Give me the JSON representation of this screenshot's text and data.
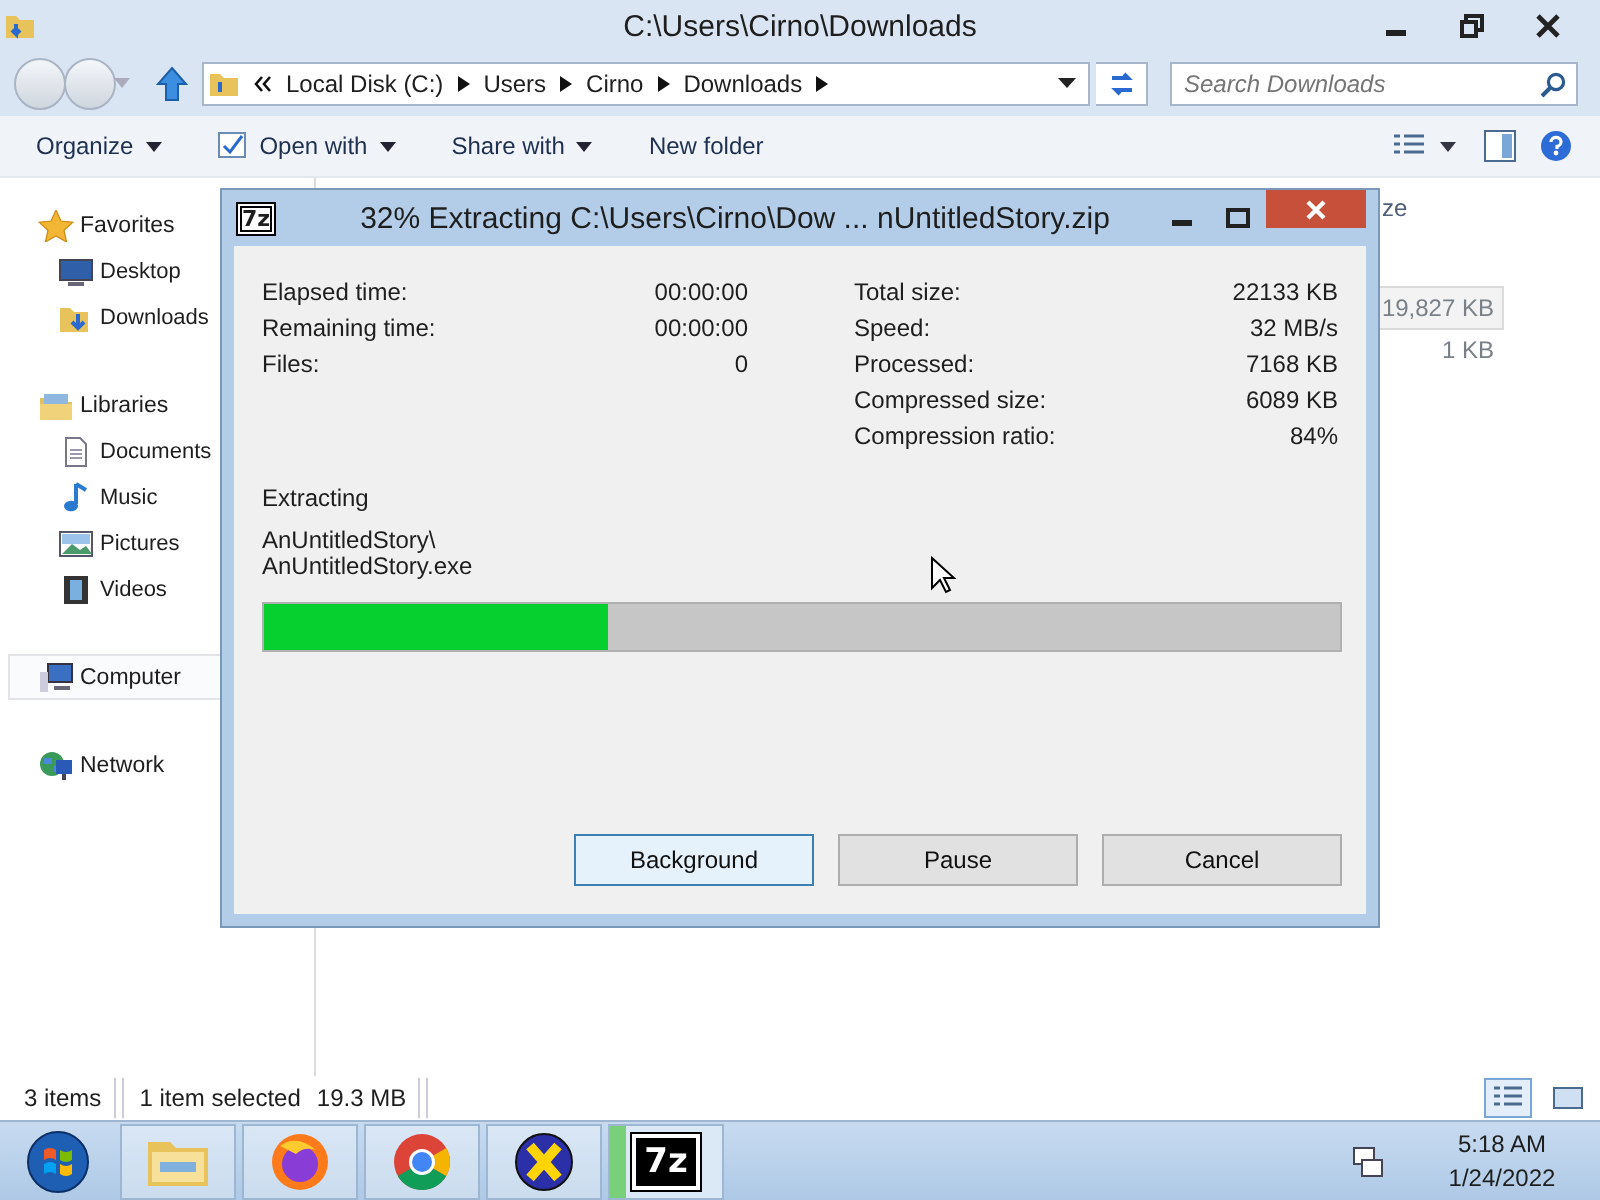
{
  "explorer": {
    "title": "C:\\Users\\Cirno\\Downloads",
    "address": {
      "crumbs": [
        "Local Disk (C:)",
        "Users",
        "Cirno",
        "Downloads"
      ]
    },
    "search": {
      "placeholder": "Search Downloads"
    },
    "commands": [
      {
        "label": "Open with",
        "kind": "openwith"
      },
      {
        "label": "Share with",
        "kind": "menu"
      },
      {
        "label": "New folder",
        "kind": "plain"
      }
    ],
    "organize": {
      "label": "Organize"
    },
    "sidebar": [
      {
        "label": "Favorites",
        "kind": "star",
        "selected": false,
        "children": [
          {
            "label": "Desktop",
            "kind": "desktop",
            "selected": false
          },
          {
            "label": "Downloads",
            "kind": "downloads",
            "selected": false
          }
        ]
      },
      {
        "label": "Libraries",
        "kind": "library",
        "selected": false,
        "children": [
          {
            "label": "Documents",
            "kind": "document",
            "selected": false
          },
          {
            "label": "Music",
            "kind": "music",
            "selected": false
          },
          {
            "label": "Pictures",
            "kind": "pictures",
            "selected": false
          },
          {
            "label": "Videos",
            "kind": "videos",
            "selected": false
          }
        ]
      },
      {
        "label": "Computer",
        "kind": "computer",
        "selected": true
      },
      {
        "label": "Network",
        "kind": "network",
        "selected": false
      }
    ],
    "file_list": {
      "column_1": "ze",
      "rows": [
        {
          "size": "19,827 KB",
          "selected": true
        },
        {
          "size": "1 KB",
          "selected": false
        }
      ]
    },
    "status_bar": {
      "count": "3 items",
      "selection": "1 item selected",
      "size": "19.3 MB"
    }
  },
  "dialog": {
    "logo": "7z",
    "title": "32% Extracting C:\\Users\\Cirno\\Dow ... nUntitledStory.zip",
    "left_stats": [
      {
        "label": "Elapsed time:",
        "value": "00:00:00"
      },
      {
        "label": "Remaining time:",
        "value": "00:00:00"
      },
      {
        "label": "Files:",
        "value": "0"
      }
    ],
    "right_stats": [
      {
        "label": "Total size:",
        "value": "22133 KB"
      },
      {
        "label": "Speed:",
        "value": "32 MB/s"
      },
      {
        "label": "Processed:",
        "value": "7168 KB"
      },
      {
        "label": "Compressed size:",
        "value": "6089 KB"
      },
      {
        "label": "Compression ratio:",
        "value": "84%"
      }
    ],
    "operation": "Extracting",
    "current_path": [
      "AnUntitledStory\\",
      "AnUntitledStory.exe"
    ],
    "progress": {
      "level": 0.32
    },
    "buttons": [
      {
        "label": "Background",
        "focused": true
      },
      {
        "label": "Pause",
        "focused": false
      },
      {
        "label": "Cancel",
        "focused": false
      }
    ]
  },
  "taskbar": {
    "apps": [
      {
        "kind": "explorer",
        "active": false
      },
      {
        "kind": "firefox",
        "active": false
      },
      {
        "kind": "chrome",
        "active": false
      },
      {
        "kind": "xapp",
        "active": false
      },
      {
        "kind": "sevenzip",
        "active": true,
        "logo": "7z"
      }
    ],
    "time": "5:18 AM",
    "date": "1/24/2022"
  }
}
